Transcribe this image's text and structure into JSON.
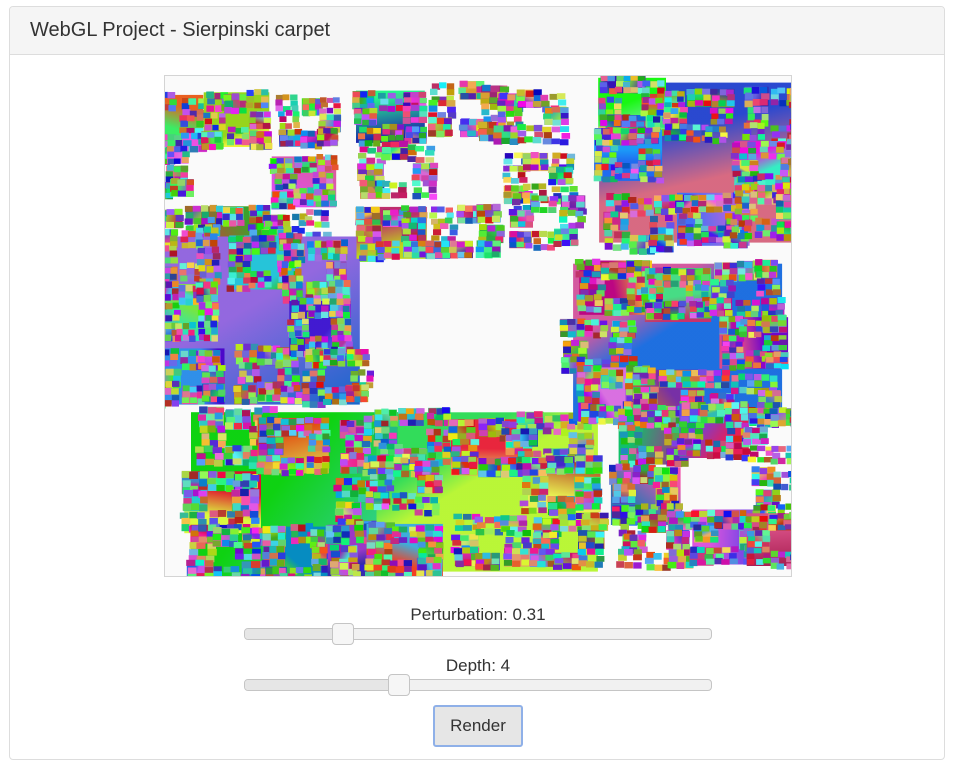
{
  "header": {
    "title": "WebGL Project - Sierpinski carpet"
  },
  "canvas": {
    "background": "#fafafa",
    "depth": 4,
    "perturbation": 0.31
  },
  "controls": {
    "perturbation": {
      "label": "Perturbation:",
      "value": "0.31",
      "fraction": 0.21
    },
    "depth": {
      "label": "Depth:",
      "value": "4",
      "fraction": 0.33
    },
    "render_label": "Render"
  },
  "colors": {
    "panel_heading_bg": "#f5f5f5",
    "panel_border": "#dddddd",
    "button_focus_border": "#8fb0e8"
  }
}
